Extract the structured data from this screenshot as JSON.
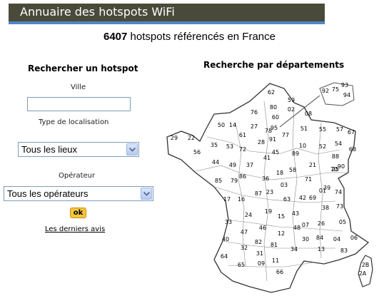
{
  "header": {
    "title": "Annuaire des hotspots WiFi"
  },
  "summary": {
    "count": "6407",
    "text": "hotspots référencés en France"
  },
  "search": {
    "title": "Rechercher un hotspot",
    "ville_label": "Ville",
    "ville_value": "",
    "type_label": "Type de localisation",
    "type_value": "Tous les lieux",
    "operator_label": "Opérateur",
    "operator_value": "Tous les opérateurs",
    "ok_label": "ok",
    "reviews_link": "Les derniers avis"
  },
  "map": {
    "title": "Recherche par départements",
    "departments": [
      "62",
      "59",
      "80",
      "02",
      "08",
      "76",
      "60",
      "14",
      "27",
      "95",
      "78",
      "91",
      "77",
      "50",
      "61",
      "28",
      "51",
      "55",
      "57",
      "67",
      "29",
      "22",
      "35",
      "72",
      "45",
      "10",
      "52",
      "54",
      "88",
      "56",
      "53",
      "44",
      "49",
      "37",
      "41",
      "89",
      "21",
      "70",
      "90",
      "68",
      "86",
      "36",
      "18",
      "58",
      "71",
      "39",
      "25",
      "85",
      "79",
      "87",
      "03",
      "23",
      "63",
      "42",
      "01",
      "69",
      "74",
      "73",
      "38",
      "17",
      "16",
      "24",
      "19",
      "15",
      "43",
      "07",
      "26",
      "05",
      "04",
      "06",
      "33",
      "47",
      "46",
      "12",
      "48",
      "30",
      "84",
      "13",
      "83",
      "40",
      "82",
      "81",
      "34",
      "32",
      "31",
      "11",
      "64",
      "65",
      "09",
      "66",
      "92",
      "75",
      "93",
      "94",
      "2B",
      "2A"
    ]
  }
}
